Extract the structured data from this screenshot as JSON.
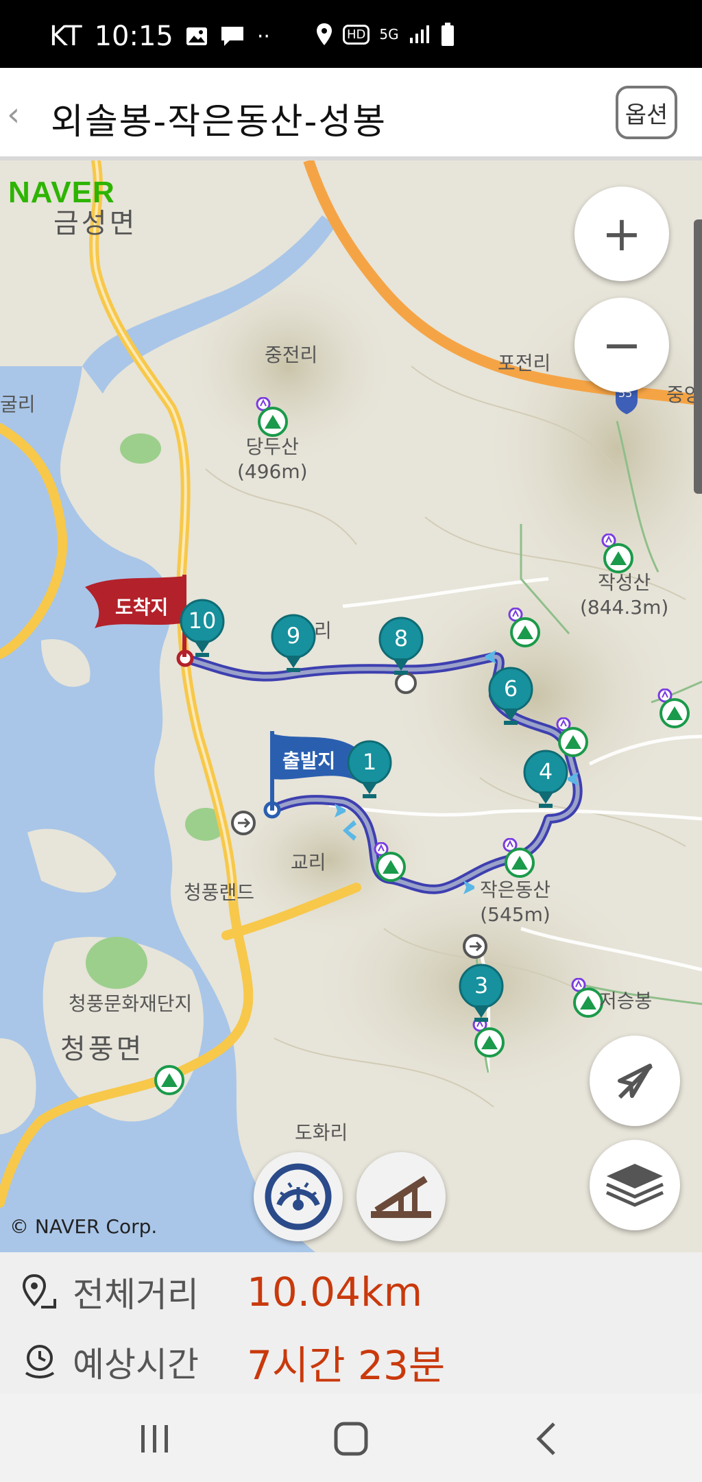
{
  "status_bar": {
    "carrier": "KT",
    "time": "10:15",
    "network_label": "5G",
    "hd_label": "HD"
  },
  "app_bar": {
    "back_icon": "chevron-left-icon",
    "title": "외솔봉-작은동산-성봉",
    "option_label": "옵션"
  },
  "map": {
    "provider_logo": "NAVER",
    "copyright": "© NAVER Corp.",
    "labels": {
      "geumseong": "금성면",
      "jungjeon": "중전리",
      "pojeon": "포전리",
      "jungang": "중앙",
      "guri": "굴리",
      "dangdusan": "당두산",
      "dangdusan_height": "(496m)",
      "jakseongsan": "작성산",
      "jakseongsan_height": "(844.3m)",
      "ri_partial": "리",
      "gyori": "교리",
      "cheongpungland": "청풍랜드",
      "jageundongsan": "작은동산",
      "jageundongsan_height": "(545m)",
      "jeoseungbong": "저승봉",
      "cheongpung_culture": "청풍문화재단지",
      "cheongpung_myeon": "청풍면",
      "dohwari": "도화리",
      "highway_number": "55"
    },
    "flags": {
      "arrival": "도착지",
      "departure": "출발지"
    },
    "waypoints": [
      "1",
      "3",
      "4",
      "6",
      "8",
      "9",
      "10"
    ],
    "controls": {
      "zoom_in": "+",
      "zoom_out": "−"
    },
    "colors": {
      "route": "#3d3fb0",
      "waypoint": "#16919d",
      "arrival_flag": "#b3212a",
      "departure_flag": "#2a5fb0",
      "water": "#a9c6e8",
      "road": "#f7c84a",
      "highway": "#f5a445"
    }
  },
  "summary": {
    "distance_label": "전체거리",
    "distance_value": "10.04km",
    "time_label": "예상시간",
    "time_value": "7시간 23분"
  },
  "nav_bar": {
    "recent_icon": "recent-apps-icon",
    "home_icon": "home-icon",
    "back_icon": "back-icon"
  }
}
